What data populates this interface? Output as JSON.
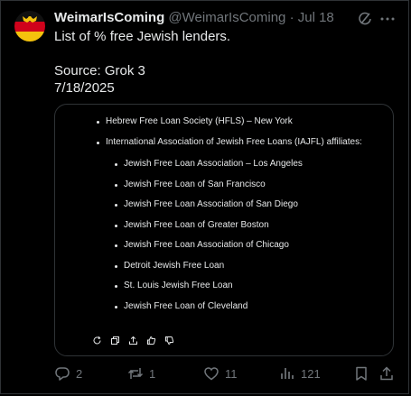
{
  "tweet": {
    "display_name": "WeimarIsComing",
    "handle": "@WeimarIsComing",
    "separator": "·",
    "date": "Jul 18",
    "text": "List of % free Jewish lenders.\n\nSource: Grok 3\n7/18/2025",
    "icons": [
      "grok-icon",
      "more-icon"
    ]
  },
  "media": {
    "items": [
      "Hebrew Free Loan Society (HFLS) – New York",
      "International Association of Jewish Free Loans (IAJFL) affiliates:"
    ],
    "subitems": [
      "Jewish Free Loan Association – Los Angeles",
      "Jewish Free Loan of San Francisco",
      "Jewish Free Loan Association of San Diego",
      "Jewish Free Loan of Greater Boston",
      "Jewish Free Loan Association of Chicago",
      "Detroit Jewish Free Loan",
      "St. Louis Jewish Free Loan",
      "Jewish Free Loan of Cleveland"
    ],
    "tool_icons": [
      "refresh-icon",
      "copy-icon",
      "share-icon",
      "thumbs-up-icon",
      "thumbs-down-icon"
    ]
  },
  "actions": {
    "replies": "2",
    "reposts": "1",
    "likes": "11",
    "views": "121"
  },
  "colors": {
    "background": "#000000",
    "text": "#e7e9ea",
    "muted": "#71767b",
    "border": "#2f3336",
    "flag_black": "#111111",
    "flag_red": "#d0021b",
    "flag_gold": "#f4c20d"
  }
}
